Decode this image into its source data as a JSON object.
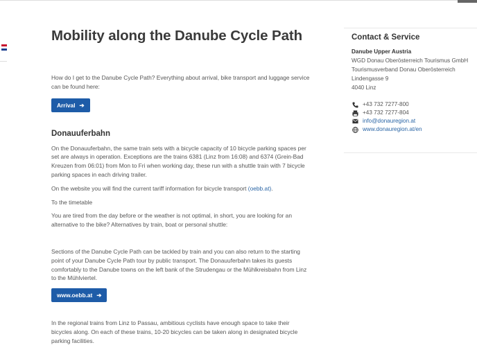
{
  "page": {
    "title": "Mobility along the Danube Cycle Path",
    "intro": "How do I get to the Danube Cycle Path? Everything about arrival, bike transport and luggage service can be found here:",
    "arrival_button": "Arrival",
    "section_heading": "Donauuferbahn",
    "para1": "On the Donauuferbahn, the same train sets with a bicycle capacity of 10 bicycle parking spaces per set are always in operation. Exceptions are the trains 6381 (Linz from 16:08) and 6374 (Grein-Bad Kreuzen from 06:01) from Mon to Fri when working day, these run with a shuttle train with 7 bicycle parking spaces in each driving trailer.",
    "para2_text": "On the website you will find the current tariff information for bicycle transport ",
    "para2_link": "(oebb.at)",
    "para2_end": ".",
    "para3": "To the timetable",
    "para4": "You are tired from the day before or the weather is not optimal, in short, you are looking for an alternative to the bike? Alternatives by train, boat or personal shuttle:",
    "para5": "Sections of the Danube Cycle Path can be tackled by train and you can also return to the starting point of your Danube Cycle Path tour by public transport. The Donauuferbahn takes its guests comfortably to the Danube towns on the left bank of the Strudengau or the Mühlkreisbahn from Linz to the Mühlviertel.",
    "oebb_button": "www.oebb.at",
    "para6": "In the regional trains from Linz to Passau, ambitious cyclists have enough space to take their bicycles along. On each of these trains, 10-20 bicycles can be taken along in designated bicycle parking facilities."
  },
  "sidebar": {
    "heading": "Contact & Service",
    "org": "Danube Upper Austria",
    "address_lines": [
      "WGD Donau Oberösterreich Tourismus GmbH",
      "Tourismusverband Donau Oberösterreich",
      "Lindengasse 9",
      "4040 Linz"
    ],
    "phone": "+43 732 7277-800",
    "fax": "+43 732 7277-804",
    "email": "info@donauregion.at",
    "web": "www.donauregion.at/en"
  },
  "colors": {
    "accent": "#1e5ca8",
    "link": "#2a65a5"
  },
  "icons": {
    "phone": "phone-icon",
    "fax": "fax-icon",
    "email": "envelope-icon",
    "web": "globe-icon",
    "arrow": "arrow-right-icon"
  }
}
